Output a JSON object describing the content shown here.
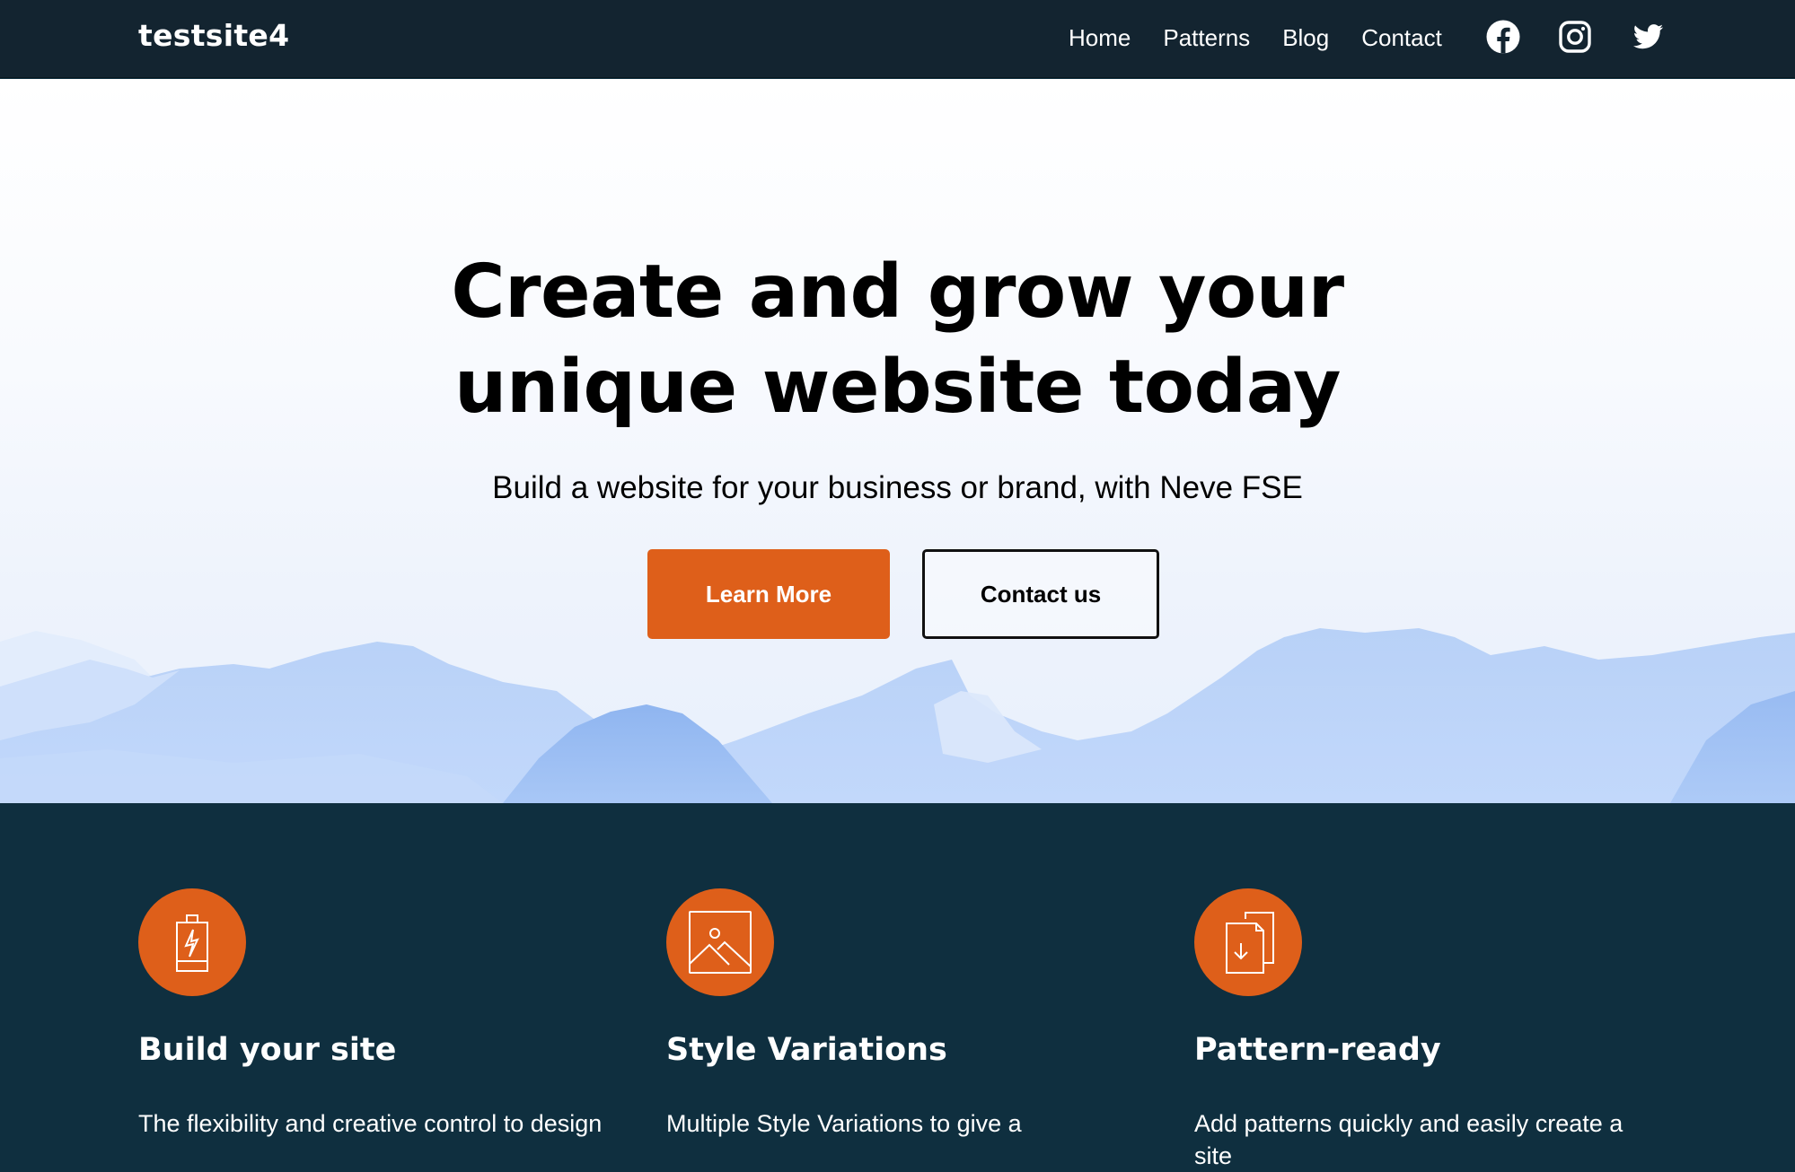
{
  "header": {
    "site_title": "testsite4",
    "nav": [
      {
        "label": "Home"
      },
      {
        "label": "Patterns"
      },
      {
        "label": "Blog"
      },
      {
        "label": "Contact"
      }
    ],
    "social": [
      {
        "name": "facebook-icon"
      },
      {
        "name": "instagram-icon"
      },
      {
        "name": "twitter-icon"
      }
    ]
  },
  "hero": {
    "title_line1": "Create and grow your",
    "title_line2": "unique website today",
    "subtitle": "Build a website for your business or brand, with Neve FSE",
    "primary_button": "Learn More",
    "secondary_button": "Contact us"
  },
  "features": [
    {
      "icon": "battery-bolt-icon",
      "title": "Build your site",
      "text": "The flexibility and creative control to design"
    },
    {
      "icon": "image-icon",
      "title": "Style Variations",
      "text": "Multiple Style Variations to give a"
    },
    {
      "icon": "documents-download-icon",
      "title": "Pattern-ready",
      "text": "Add patterns quickly and easily create a site"
    }
  ],
  "colors": {
    "header_bg": "#132430",
    "accent": "#de5f1a",
    "features_bg": "#0f2f3f",
    "text_dark": "#000000",
    "text_light": "#ffffff"
  }
}
